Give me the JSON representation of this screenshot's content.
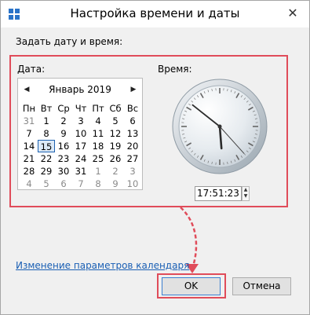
{
  "window": {
    "title": "Настройка времени и даты",
    "close_glyph": "✕"
  },
  "section_label": "Задать дату и время:",
  "date": {
    "label": "Дата:",
    "month_year": "Январь 2019",
    "weekdays": [
      "Пн",
      "Вт",
      "Ср",
      "Чт",
      "Пт",
      "Сб",
      "Вс"
    ],
    "weeks": [
      [
        "31",
        "1",
        "2",
        "3",
        "4",
        "5",
        "6"
      ],
      [
        "7",
        "8",
        "9",
        "10",
        "11",
        "12",
        "13"
      ],
      [
        "14",
        "15",
        "16",
        "17",
        "18",
        "19",
        "20"
      ],
      [
        "21",
        "22",
        "23",
        "24",
        "25",
        "26",
        "27"
      ],
      [
        "28",
        "29",
        "30",
        "31",
        "1",
        "2",
        "3"
      ],
      [
        "4",
        "5",
        "6",
        "7",
        "8",
        "9",
        "10"
      ]
    ],
    "muted": [
      [
        0,
        0
      ],
      [
        4,
        4
      ],
      [
        4,
        5
      ],
      [
        4,
        6
      ],
      [
        5,
        0
      ],
      [
        5,
        1
      ],
      [
        5,
        2
      ],
      [
        5,
        3
      ],
      [
        5,
        4
      ],
      [
        5,
        5
      ],
      [
        5,
        6
      ]
    ],
    "selected_day": "15"
  },
  "time": {
    "label": "Время:",
    "value": "17:51:23",
    "hour": 17,
    "minute": 51,
    "second": 23
  },
  "link": {
    "label": "Изменение параметров календаря"
  },
  "buttons": {
    "ok": "OK",
    "cancel": "Отмена"
  },
  "colors": {
    "highlight": "#e04c5a",
    "link": "#1a5fb4"
  }
}
